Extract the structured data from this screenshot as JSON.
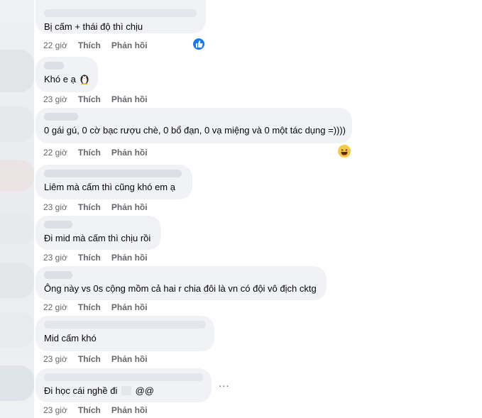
{
  "comments": [
    {
      "text": "Bị cấm + thái độ thì chịu",
      "time": "22 giờ",
      "like": "Thích",
      "reply": "Phản hồi"
    },
    {
      "text": "Khó e ạ",
      "time": "23 giờ",
      "like": "Thích",
      "reply": "Phản hồi"
    },
    {
      "text": "0 gái gú, 0 cờ bạc rượu chè, 0 bổ đạn, 0 vạ miệng và 0 một tác dụng =))))",
      "time": "22 giờ",
      "like": "Thích",
      "reply": "Phản hồi"
    },
    {
      "text": "Liêm mà cấm thì cũng khó em ạ",
      "time": "23 giờ",
      "like": "Thích",
      "reply": "Phản hồi"
    },
    {
      "text": "Đi mid mà cấm thì chịu rồi",
      "time": "23 giờ",
      "like": "Thích",
      "reply": "Phản hồi"
    },
    {
      "text": "Ông này vs 0s cộng mồm cả hai r chia đôi là vn có đội vô địch cktg",
      "time": "22 giờ",
      "like": "Thích",
      "reply": "Phản hồi"
    },
    {
      "text": "Mid cấm khó",
      "time": "23 giờ",
      "like": "Thích",
      "reply": "Phản hồi"
    },
    {
      "text_before": "Đi học cái nghề đi",
      "text_after": "@@",
      "time": "23 giờ",
      "like": "Thích",
      "reply": "Phản hồi"
    }
  ],
  "more_label": "...",
  "icons": {
    "like_reaction": "like-reaction-icon",
    "haha_reaction": "haha-reaction-icon",
    "penguin": "penguin-emoji-icon"
  }
}
